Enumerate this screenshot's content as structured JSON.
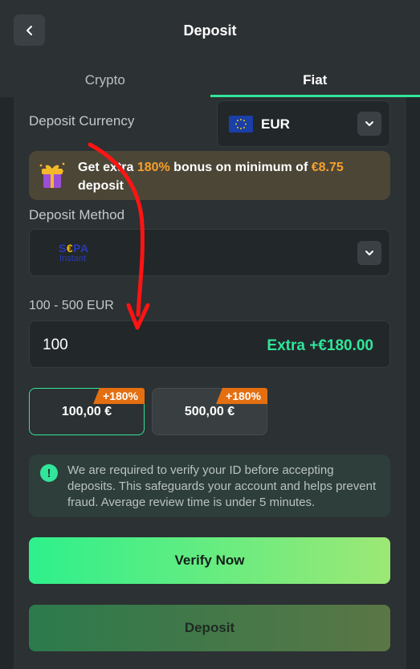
{
  "header": {
    "title": "Deposit",
    "back_icon": "chevron-left-icon"
  },
  "tabs": [
    {
      "label": "Crypto",
      "active": false
    },
    {
      "label": "Fiat",
      "active": true
    }
  ],
  "deposit_currency": {
    "label": "Deposit Currency",
    "selected": "EUR",
    "flag_icon": "eu-flag-icon"
  },
  "promo": {
    "prefix": "Get extra ",
    "percent": "180%",
    "middle": " bonus on minimum of ",
    "minimum": "€8.75",
    "suffix": " deposit",
    "icon": "gift-icon"
  },
  "deposit_method": {
    "label": "Deposit Method",
    "logo_main_pre": "S",
    "logo_main_euro": "€",
    "logo_main_post": "PA",
    "logo_sub": "Instant"
  },
  "amount": {
    "range_label": "100 - 500 EUR",
    "value": "100",
    "extra": "Extra +€180.00"
  },
  "presets": [
    {
      "amount": "100,00 €",
      "badge": "+180%",
      "selected": true
    },
    {
      "amount": "500,00 €",
      "badge": "+180%",
      "selected": false
    }
  ],
  "notice": {
    "icon": "exclamation-icon",
    "text": "We are required to verify your ID before accepting deposits. This safeguards your account and helps prevent fraud. Average review time is under 5 minutes."
  },
  "buttons": {
    "verify": "Verify Now",
    "deposit": "Deposit"
  },
  "colors": {
    "accent": "#31e59a",
    "promo_highlight": "#f5a12b",
    "badge": "#e46f10",
    "annotation_arrow": "#ff0000"
  }
}
